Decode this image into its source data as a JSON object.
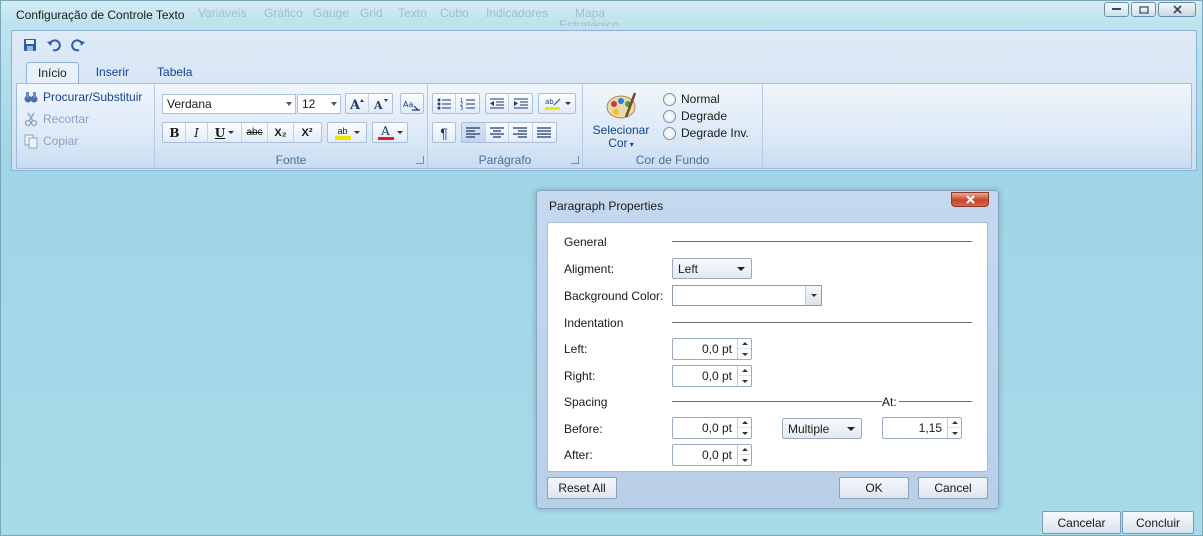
{
  "window": {
    "title": "Configuração de Controle Texto",
    "ghost_menu": [
      "Variáveis",
      "Gráfico",
      "Gauge",
      "Grid",
      "Texto",
      "Cubo",
      "Indicadores",
      "Mapa",
      "Estratégico"
    ]
  },
  "ribbon": {
    "tabs": [
      "Início",
      "Inserir",
      "Tabela"
    ],
    "active_tab": "Início",
    "clipboard": {
      "find_replace": "Procurar/Substituir",
      "cut": "Recortar",
      "copy": "Copiar"
    },
    "font": {
      "label": "Fonte",
      "family": "Verdana",
      "size": "12",
      "bold": "B",
      "italic": "I",
      "underline": "U",
      "strike": "abc",
      "subscript": "X₂",
      "superscript": "X²",
      "color_glyph": "A",
      "highlight_glyph": "ab"
    },
    "paragraph": {
      "label": "Parágrafo",
      "pilcrow": "¶"
    },
    "background": {
      "label": "Cor de Fundo",
      "select_color_line1": "Selecionar",
      "select_color_line2": "Cor",
      "options": [
        "Normal",
        "Degrade",
        "Degrade Inv."
      ]
    }
  },
  "colors": {
    "ribbon_text": "#15428b",
    "font_color_bar": "#e02020",
    "highlight_bar": "#f5e400"
  },
  "footer": {
    "cancel": "Cancelar",
    "finish": "Concluir"
  },
  "dialog": {
    "title": "Paragraph Properties",
    "close": "x",
    "general": "General",
    "alignment_label": "Aligment:",
    "alignment_value": "Left",
    "background_label": "Background Color:",
    "indentation": "Indentation",
    "left_label": "Left:",
    "left_value": "0,0 pt",
    "right_label": "Right:",
    "right_value": "0,0 pt",
    "spacing": "Spacing",
    "at_label": "At:",
    "before_label": "Before:",
    "before_value": "0,0 pt",
    "line_spacing": "Multiple",
    "at_value": "1,15",
    "after_label": "After:",
    "after_value": "0,0 pt",
    "reset": "Reset All",
    "ok": "OK",
    "cancel": "Cancel"
  }
}
